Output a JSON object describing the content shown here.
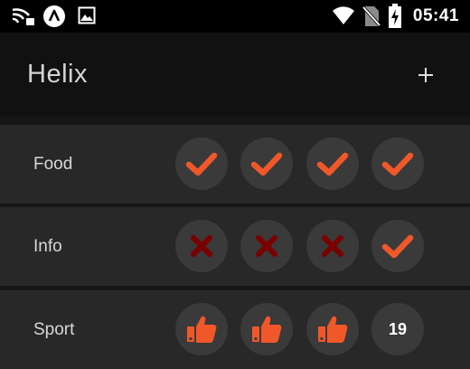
{
  "status_bar": {
    "time": "05:41",
    "icons": [
      "cast-icon",
      "app-logo-icon",
      "image-icon",
      "wifi-icon",
      "no-sim-icon",
      "battery-charging-icon"
    ]
  },
  "app_bar": {
    "title": "Helix",
    "add_icon": "plus-icon"
  },
  "colors": {
    "accent": "#f0582a",
    "failed": "#7a0000",
    "row": "#282828",
    "cell": "#3a3a3a"
  },
  "habits": [
    {
      "name": "Food",
      "days": [
        "check",
        "check",
        "check",
        "check"
      ]
    },
    {
      "name": "Info",
      "days": [
        "cross",
        "cross",
        "cross",
        "check"
      ]
    },
    {
      "name": "Sport",
      "days": [
        "thumb",
        "thumb",
        "thumb",
        "19"
      ]
    }
  ]
}
